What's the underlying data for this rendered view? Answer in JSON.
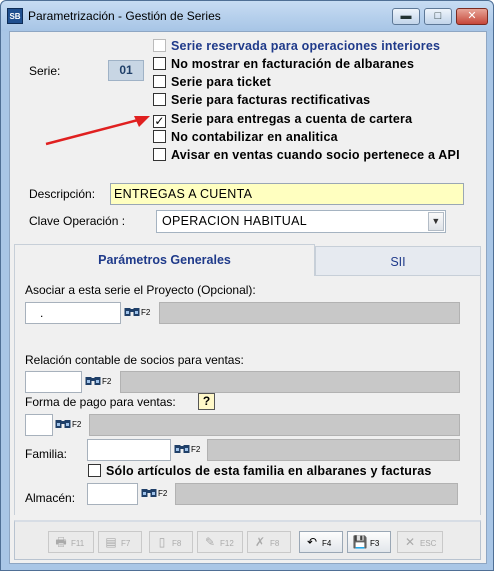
{
  "window": {
    "app_icon": "SB",
    "title": "Parametrización - Gestión de Series",
    "minimize_glyph": "▬",
    "maximize_glyph": "□",
    "close_glyph": "✕"
  },
  "serie": {
    "label": "Serie:",
    "value": "01"
  },
  "checkboxes": [
    {
      "label": "Serie reservada para operaciones interiores",
      "checked": false,
      "mark": "",
      "enabled": false
    },
    {
      "label": "No mostrar en facturación de albaranes",
      "checked": false,
      "mark": "",
      "enabled": true
    },
    {
      "label": "Serie para ticket",
      "checked": false,
      "mark": "",
      "enabled": true
    },
    {
      "label": "Serie para facturas rectificativas",
      "checked": false,
      "mark": "",
      "enabled": true
    },
    {
      "label": "Serie para entregas a cuenta de cartera",
      "checked": true,
      "mark": "✓",
      "enabled": true
    },
    {
      "label": "No contabilizar en analitica",
      "checked": false,
      "mark": "",
      "enabled": true
    },
    {
      "label": "Avisar en ventas cuando socio pertenece a API",
      "checked": false,
      "mark": "",
      "enabled": true
    }
  ],
  "annotation": {
    "color": "#e02020"
  },
  "descripcion": {
    "label": "Descripción:",
    "value": "ENTREGAS A CUENTA"
  },
  "clave_operacion": {
    "label": "Clave Operación :",
    "value": "OPERACION HABITUAL",
    "dropdown_glyph": "▼"
  },
  "tabs": [
    {
      "label": "Parámetros Generales",
      "active": true
    },
    {
      "label": "SII",
      "active": false
    }
  ],
  "general": {
    "proyecto": {
      "label": "Asociar a esta serie el Proyecto (Opcional):",
      "value": "."
    },
    "relacion": {
      "label": "Relación contable de socios para ventas:",
      "value": ""
    },
    "forma_pago": {
      "label": "Forma de pago para ventas:",
      "value": "",
      "help_glyph": "?"
    },
    "familia": {
      "label": "Familia:",
      "value": ""
    },
    "solo_familia": {
      "label": "Sólo artículos de esta familia en albaranes y facturas",
      "checked": false,
      "mark": ""
    },
    "almacen": {
      "label": "Almacén:",
      "value": ""
    },
    "search_key": "F2"
  },
  "toolbar": [
    {
      "key": "F11",
      "icon": "print-icon",
      "glyph": "🖶",
      "enabled": false
    },
    {
      "key": "F7",
      "icon": "print-preview-icon",
      "glyph": "▤",
      "enabled": false
    },
    {
      "key": "F8",
      "icon": "new-document-icon",
      "glyph": "▯",
      "enabled": false
    },
    {
      "key": "F12",
      "icon": "edit-document-icon",
      "glyph": "✎",
      "enabled": false
    },
    {
      "key": "F8",
      "icon": "delete-document-icon",
      "glyph": "✗",
      "enabled": false
    },
    {
      "key": "F4",
      "icon": "undo-icon",
      "glyph": "↶",
      "enabled": true
    },
    {
      "key": "F3",
      "icon": "save-icon",
      "glyph": "💾",
      "enabled": true
    },
    {
      "key": "ESC",
      "icon": "cancel-icon",
      "glyph": "✕",
      "enabled": false
    }
  ]
}
